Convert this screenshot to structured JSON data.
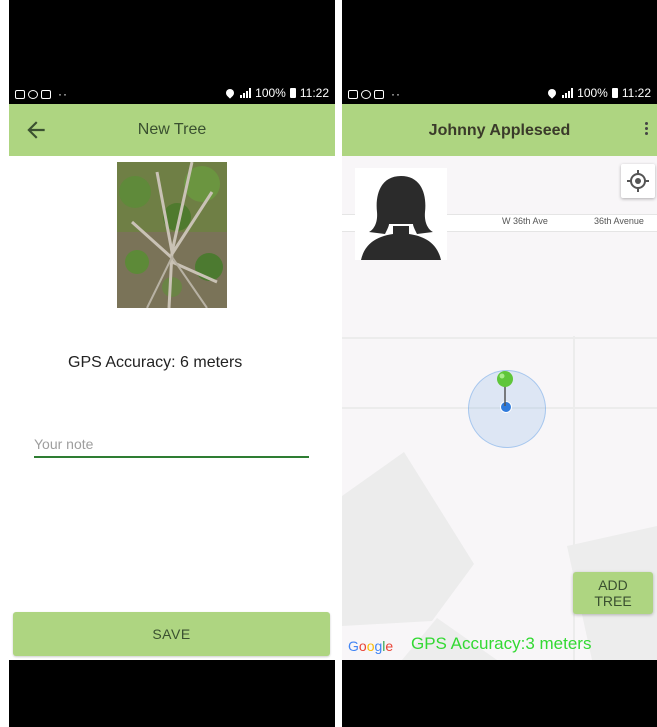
{
  "status_bar": {
    "battery": "100%",
    "time": "11:22",
    "dots": "··"
  },
  "new_tree_screen": {
    "title": "New Tree",
    "gps_accuracy": "GPS Accuracy:  6 meters",
    "note_placeholder": "Your note",
    "note_value": "",
    "save_label": "SAVE"
  },
  "map_screen": {
    "title": "Johnny Appleseed",
    "streets": [
      "W 36th Ave",
      "36th Avenue"
    ],
    "add_tree_label": "ADD TREE",
    "gps_accuracy": "GPS Accuracy:3 meters",
    "google_logo": [
      "G",
      "o",
      "o",
      "g",
      "l",
      "e"
    ]
  },
  "colors": {
    "app_bar": "#aed581",
    "accent_green": "#2e7d32",
    "gps_text_green": "#33d933",
    "location_blue": "#2f7bdc",
    "google_blue": "#4285f4",
    "google_red": "#ea4335",
    "google_yellow": "#fbbc05",
    "google_green": "#34a853"
  },
  "icons": {
    "back": "arrow-left-icon",
    "menu": "more-vert-icon",
    "locate": "my-location-icon",
    "marker": "map-pin-icon",
    "avatar": "user-silhouette-icon"
  }
}
